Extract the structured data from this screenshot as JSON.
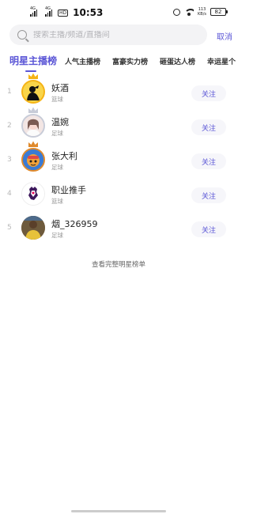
{
  "status_bar": {
    "signal1_label": "4G",
    "signal2_label": "4G",
    "hd_label": "HD",
    "time": "10:53",
    "net_speed_value": "113",
    "net_speed_unit": "KB/s",
    "battery": "82"
  },
  "search": {
    "placeholder": "搜索主播/频道/直播间",
    "cancel_label": "取消"
  },
  "tabs": [
    {
      "label": "明星主播榜",
      "active": true
    },
    {
      "label": "人气主播榜",
      "active": false
    },
    {
      "label": "富豪实力榜",
      "active": false
    },
    {
      "label": "砸蛋达人榜",
      "active": false
    },
    {
      "label": "幸运星个",
      "active": false
    }
  ],
  "ranking": [
    {
      "rank": "1",
      "name": "妖酒",
      "category": "篮球",
      "follow_label": "关注",
      "crown": "gold",
      "avatar_icon": "silhouette-avatar-icon"
    },
    {
      "rank": "2",
      "name": "温婉",
      "category": "足球",
      "follow_label": "关注",
      "crown": "silver",
      "avatar_icon": "girl-avatar-icon"
    },
    {
      "rank": "3",
      "name": "张大利",
      "category": "足球",
      "follow_label": "关注",
      "crown": "bronze",
      "avatar_icon": "cartoon-avatar-icon"
    },
    {
      "rank": "4",
      "name": "职业推手",
      "category": "篮球",
      "follow_label": "关注",
      "crown": "",
      "avatar_icon": "premier-league-logo-icon"
    },
    {
      "rank": "5",
      "name": "烟_326959",
      "category": "足球",
      "follow_label": "关注",
      "crown": "",
      "avatar_icon": "photo-avatar-icon"
    }
  ],
  "view_all_label": "查看完整明星榜单",
  "colors": {
    "accent": "#5a55d6",
    "crown_gold": "#f5b316",
    "crown_silver": "#c8ccd8",
    "crown_bronze": "#e08a2c"
  }
}
